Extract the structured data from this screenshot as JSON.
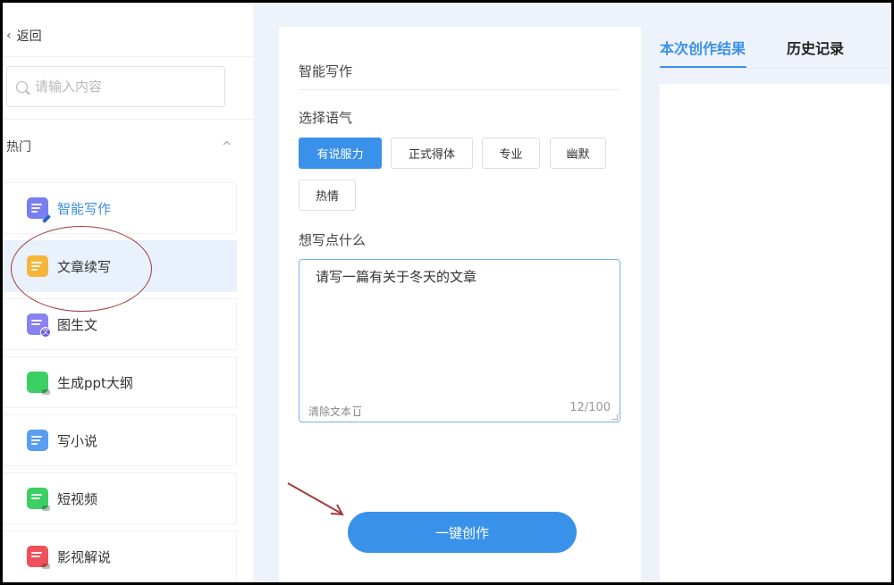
{
  "sidebar": {
    "back_label": "返回",
    "search_placeholder": "请输入内容",
    "group_title": "热门",
    "items": [
      {
        "label": "智能写作",
        "icon": "smart-writing-icon",
        "color": "#7b7ef0"
      },
      {
        "label": "文章续写",
        "icon": "article-continue-icon",
        "color": "#f5b53b"
      },
      {
        "label": "图生文",
        "icon": "image-to-text-icon",
        "color": "#8a82f0"
      },
      {
        "label": "生成ppt大纲",
        "icon": "ppt-outline-icon",
        "color": "#3ccf63"
      },
      {
        "label": "写小说",
        "icon": "novel-icon",
        "color": "#5b9df0"
      },
      {
        "label": "短视频",
        "icon": "short-video-icon",
        "color": "#3ccf63"
      },
      {
        "label": "影视解说",
        "icon": "film-commentary-icon",
        "color": "#f0505a"
      }
    ]
  },
  "form": {
    "title": "智能写作",
    "tone_label": "选择语气",
    "tones": [
      "有说服力",
      "正式得体",
      "专业",
      "幽默",
      "热情"
    ],
    "selected_tone": "有说服力",
    "prompt_label": "想写点什么",
    "prompt_value": "请写一篇有关于冬天的文章",
    "clear_label": "清除文本",
    "char_count": "12/100",
    "submit_label": "一键创作"
  },
  "results": {
    "tabs": [
      "本次创作结果",
      "历史记录"
    ],
    "active_tab": "本次创作结果"
  },
  "colors": {
    "accent": "#3a91ea",
    "highlight_bg": "#e9f1fc",
    "annotation": "#a33a3a"
  }
}
